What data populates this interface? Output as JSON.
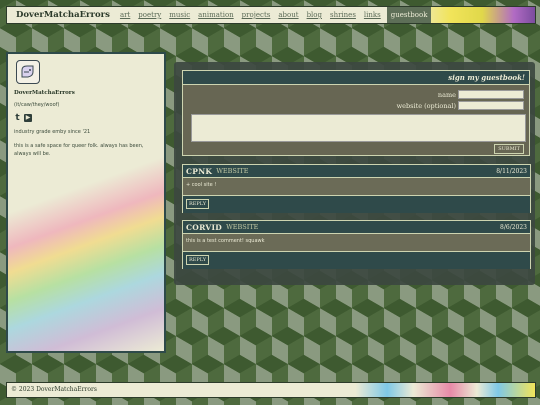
{
  "nav": {
    "brand": "DoverMatchaErrors",
    "links": [
      "art",
      "poetry",
      "music",
      "animation",
      "projects",
      "about",
      "blog",
      "shrines",
      "links"
    ],
    "active": "guestbook"
  },
  "sidebar": {
    "name": "DoverMatchaErrors",
    "pronouns": "(it/caw/they/woof)",
    "socials": [
      "t",
      "▶"
    ],
    "bio_line1": "industry grade emby since '21",
    "bio_line2": "this is a safe space for queer folk. always has been, always will be."
  },
  "guestbook": {
    "title": "sign my guestbook!",
    "name_label": "name",
    "website_label": "website (optional)",
    "submit_label": "SUBMIT",
    "comments": [
      {
        "name": "CPNK",
        "website": "WEBSITE",
        "date": "8/11/2023",
        "body": "+ cool site !",
        "reply": "REPLY"
      },
      {
        "name": "CORVID",
        "website": "WEBSITE",
        "date": "8/6/2023",
        "body": "this is a test comment! squawk",
        "reply": "REPLY"
      }
    ]
  },
  "footer": {
    "text": "© 2023 DoverMatchaErrors"
  },
  "colors": {
    "accent": "#2f4a4a",
    "cream": "#ecebd5",
    "moss": "#4e6a3e"
  }
}
